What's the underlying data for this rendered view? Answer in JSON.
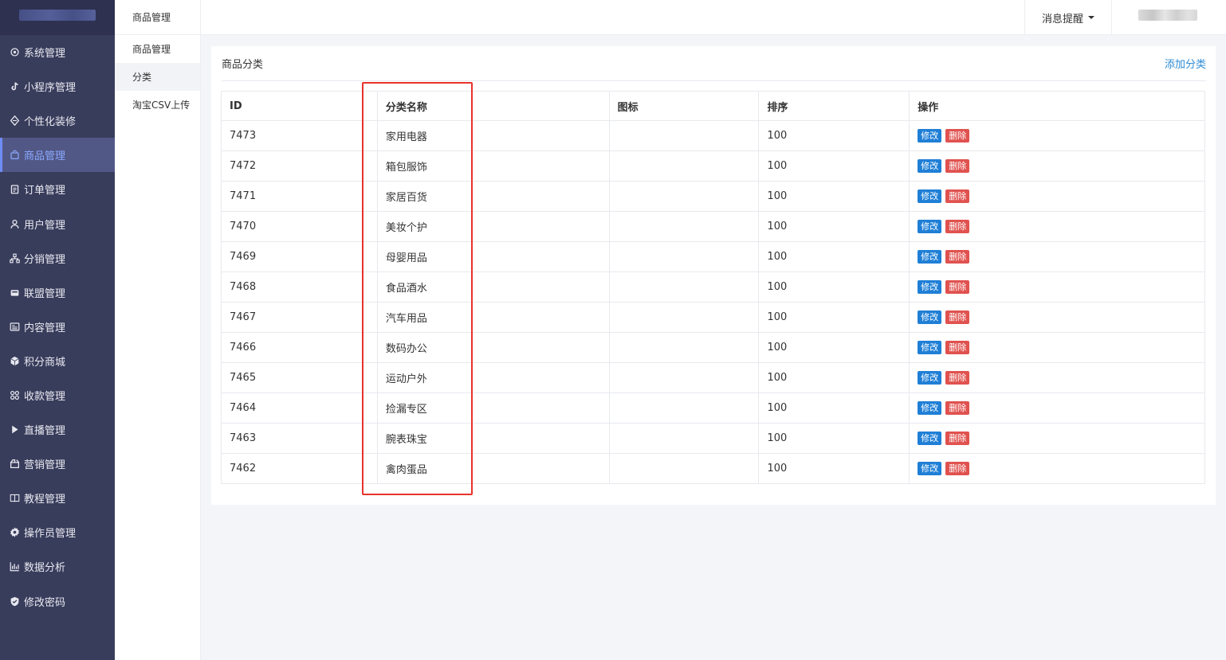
{
  "sidebar": {
    "items": [
      {
        "label": "系统管理",
        "icon": "gear-icon"
      },
      {
        "label": "小程序管理",
        "icon": "tiktok-icon"
      },
      {
        "label": "个性化装修",
        "icon": "diamond-icon"
      },
      {
        "label": "商品管理",
        "icon": "bag-icon",
        "active": true
      },
      {
        "label": "订单管理",
        "icon": "clipboard-icon"
      },
      {
        "label": "用户管理",
        "icon": "user-icon"
      },
      {
        "label": "分销管理",
        "icon": "org-chart-icon"
      },
      {
        "label": "联盟管理",
        "icon": "store-icon"
      },
      {
        "label": "内容管理",
        "icon": "newspaper-icon"
      },
      {
        "label": "积分商城",
        "icon": "cube-icon"
      },
      {
        "label": "收款管理",
        "icon": "grid-icon"
      },
      {
        "label": "直播管理",
        "icon": "play-icon"
      },
      {
        "label": "营销管理",
        "icon": "gift-icon"
      },
      {
        "label": "教程管理",
        "icon": "book-icon"
      },
      {
        "label": "操作员管理",
        "icon": "cog-icon"
      },
      {
        "label": "数据分析",
        "icon": "bar-chart-icon"
      },
      {
        "label": "修改密码",
        "icon": "shield-icon"
      }
    ]
  },
  "subnav": {
    "title": "商品管理",
    "items": [
      {
        "label": "商品管理"
      },
      {
        "label": "分类",
        "active": true
      },
      {
        "label": "淘宝CSV上传"
      }
    ]
  },
  "topbar": {
    "message_label": "消息提醒"
  },
  "main": {
    "title": "商品分类",
    "add_label": "添加分类",
    "columns": [
      "ID",
      "分类名称",
      "图标",
      "排序",
      "操作"
    ],
    "edit_label": "修改",
    "delete_label": "删除",
    "rows": [
      {
        "id": "7473",
        "name": "家用电器",
        "icon": "",
        "sort": "100"
      },
      {
        "id": "7472",
        "name": "箱包服饰",
        "icon": "",
        "sort": "100"
      },
      {
        "id": "7471",
        "name": "家居百货",
        "icon": "",
        "sort": "100"
      },
      {
        "id": "7470",
        "name": "美妆个护",
        "icon": "",
        "sort": "100"
      },
      {
        "id": "7469",
        "name": "母婴用品",
        "icon": "",
        "sort": "100"
      },
      {
        "id": "7468",
        "name": "食品酒水",
        "icon": "",
        "sort": "100"
      },
      {
        "id": "7467",
        "name": "汽车用品",
        "icon": "",
        "sort": "100"
      },
      {
        "id": "7466",
        "name": "数码办公",
        "icon": "",
        "sort": "100"
      },
      {
        "id": "7465",
        "name": "运动户外",
        "icon": "",
        "sort": "100"
      },
      {
        "id": "7464",
        "name": "捡漏专区",
        "icon": "",
        "sort": "100"
      },
      {
        "id": "7463",
        "name": "腕表珠宝",
        "icon": "",
        "sort": "100"
      },
      {
        "id": "7462",
        "name": "禽肉蛋品",
        "icon": "",
        "sort": "100"
      }
    ]
  },
  "colors": {
    "sidebar_bg": "#393d5c",
    "active_text": "#8aa8ff",
    "edit_button": "#1f7fd6",
    "delete_button": "#e0524f",
    "highlight_box": "#e8332b",
    "link": "#2f8bd4"
  }
}
